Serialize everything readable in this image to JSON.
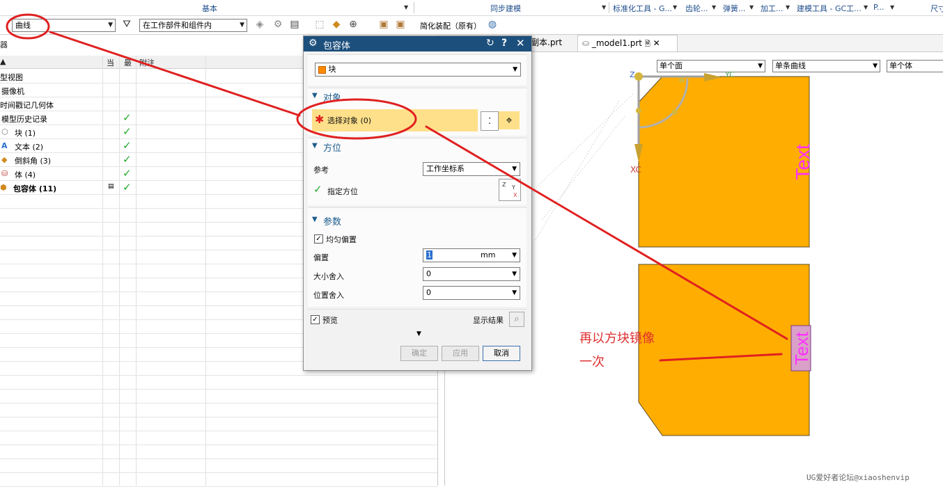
{
  "ribbon": {
    "groups": [
      "基本",
      "同步建模",
      "标准化工具 - G...",
      "齿轮...",
      "弹簧...",
      "加工...",
      "建模工具 - GC工...",
      "P...",
      "尺寸"
    ]
  },
  "toolbar": {
    "type_filter": "曲线",
    "scope_filter": "在工作部件和组件内",
    "simplify_label": "简化装配（原有）"
  },
  "navigator": {
    "title_fragment": "器",
    "columns": {
      "name": "▲",
      "current": "当",
      "latest": "最",
      "notes": "附注"
    },
    "rows": [
      {
        "label": "型视图",
        "check": false
      },
      {
        "label": "摄像机",
        "check": false
      },
      {
        "label": "时间戳记几何体",
        "check": false
      },
      {
        "label": "模型历史记录",
        "check": true
      },
      {
        "label": "块 (1)",
        "check": true,
        "icon": "block-icon"
      },
      {
        "label": "文本 (2)",
        "check": true,
        "icon": "text-icon"
      },
      {
        "label": "倒斜角 (3)",
        "check": true,
        "icon": "chamfer-icon"
      },
      {
        "label": "体 (4)",
        "check": true,
        "icon": "body-icon"
      },
      {
        "label": "包容体 (11)",
        "check": true,
        "icon": "bounding-body-icon",
        "bold": true
      }
    ]
  },
  "tabs": [
    {
      "label": "副本.prt"
    },
    {
      "label": "_model1.prt",
      "active": true
    }
  ],
  "viewport": {
    "filters": [
      "单个面",
      "单条曲线",
      "单个体"
    ],
    "axis_labels": {
      "z": "Z",
      "x": "XC",
      "y": "YC"
    },
    "model_text_top": "Text",
    "model_text_bottom": "Text",
    "annotation_line1": "再以方块镜像",
    "annotation_line2": "一次"
  },
  "dialog": {
    "title": "包容体",
    "type_value": "块",
    "sections": {
      "object": "对象",
      "orientation": "方位",
      "params": "参数"
    },
    "select_object": "选择对象 (0)",
    "reference_label": "参考",
    "reference_value": "工作坐标系",
    "specify_orientation": "指定方位",
    "uniform_offset": "均匀偏置",
    "offset_label": "偏置",
    "offset_value": "1",
    "offset_unit": "mm",
    "size_round_label": "大小舍入",
    "size_round_value": "0",
    "pos_round_label": "位置舍入",
    "pos_round_value": "0",
    "preview_label": "预览",
    "show_result_label": "显示结果",
    "ok": "确定",
    "apply": "应用",
    "cancel": "取消"
  },
  "colors": {
    "title_bar": "#1c4f7c",
    "part_fill": "#ffad00",
    "annotation": "#e03030",
    "text_magenta": "#ff2fff"
  },
  "watermark": "UG爱好者论坛@xiaoshenvip"
}
